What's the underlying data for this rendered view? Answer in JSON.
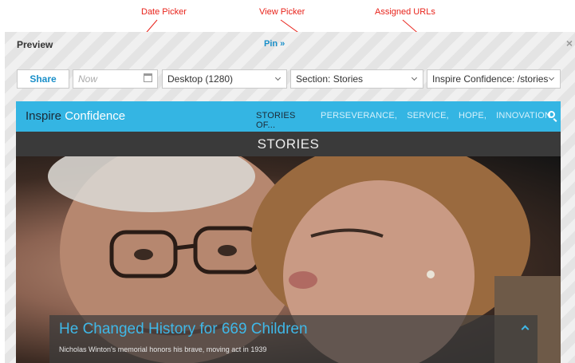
{
  "annotations": {
    "date_picker": "Date Picker",
    "view_picker": "View Picker",
    "assigned_urls": "Assigned URLs",
    "color": "#e8231b"
  },
  "preview": {
    "title": "Preview",
    "pin_label": "Pin »",
    "close_glyph": "×"
  },
  "toolbar": {
    "share_label": "Share",
    "date_placeholder": "Now",
    "view_value": "Desktop (1280)",
    "section_value": "Section: Stories",
    "url_value": "Inspire Confidence: /stories"
  },
  "site": {
    "brand_part1": "Inspire",
    "brand_part2": "Confidence",
    "nav": [
      "STORIES OF...",
      "PERSEVERANCE,",
      "SERVICE,",
      "HOPE,",
      "INNOVATION"
    ],
    "section_heading": "STORIES",
    "caption_title": "He Changed History for 669 Children",
    "caption_sub": "Nicholas Winton's memorial honors his brave, moving act in 1939",
    "accent_color": "#34b5e3"
  },
  "icons": {
    "calendar": "calendar-icon",
    "chevron": "chevron-down-icon",
    "search": "search-icon",
    "caption_toggle": "chevron-up-icon",
    "close": "close-icon"
  }
}
